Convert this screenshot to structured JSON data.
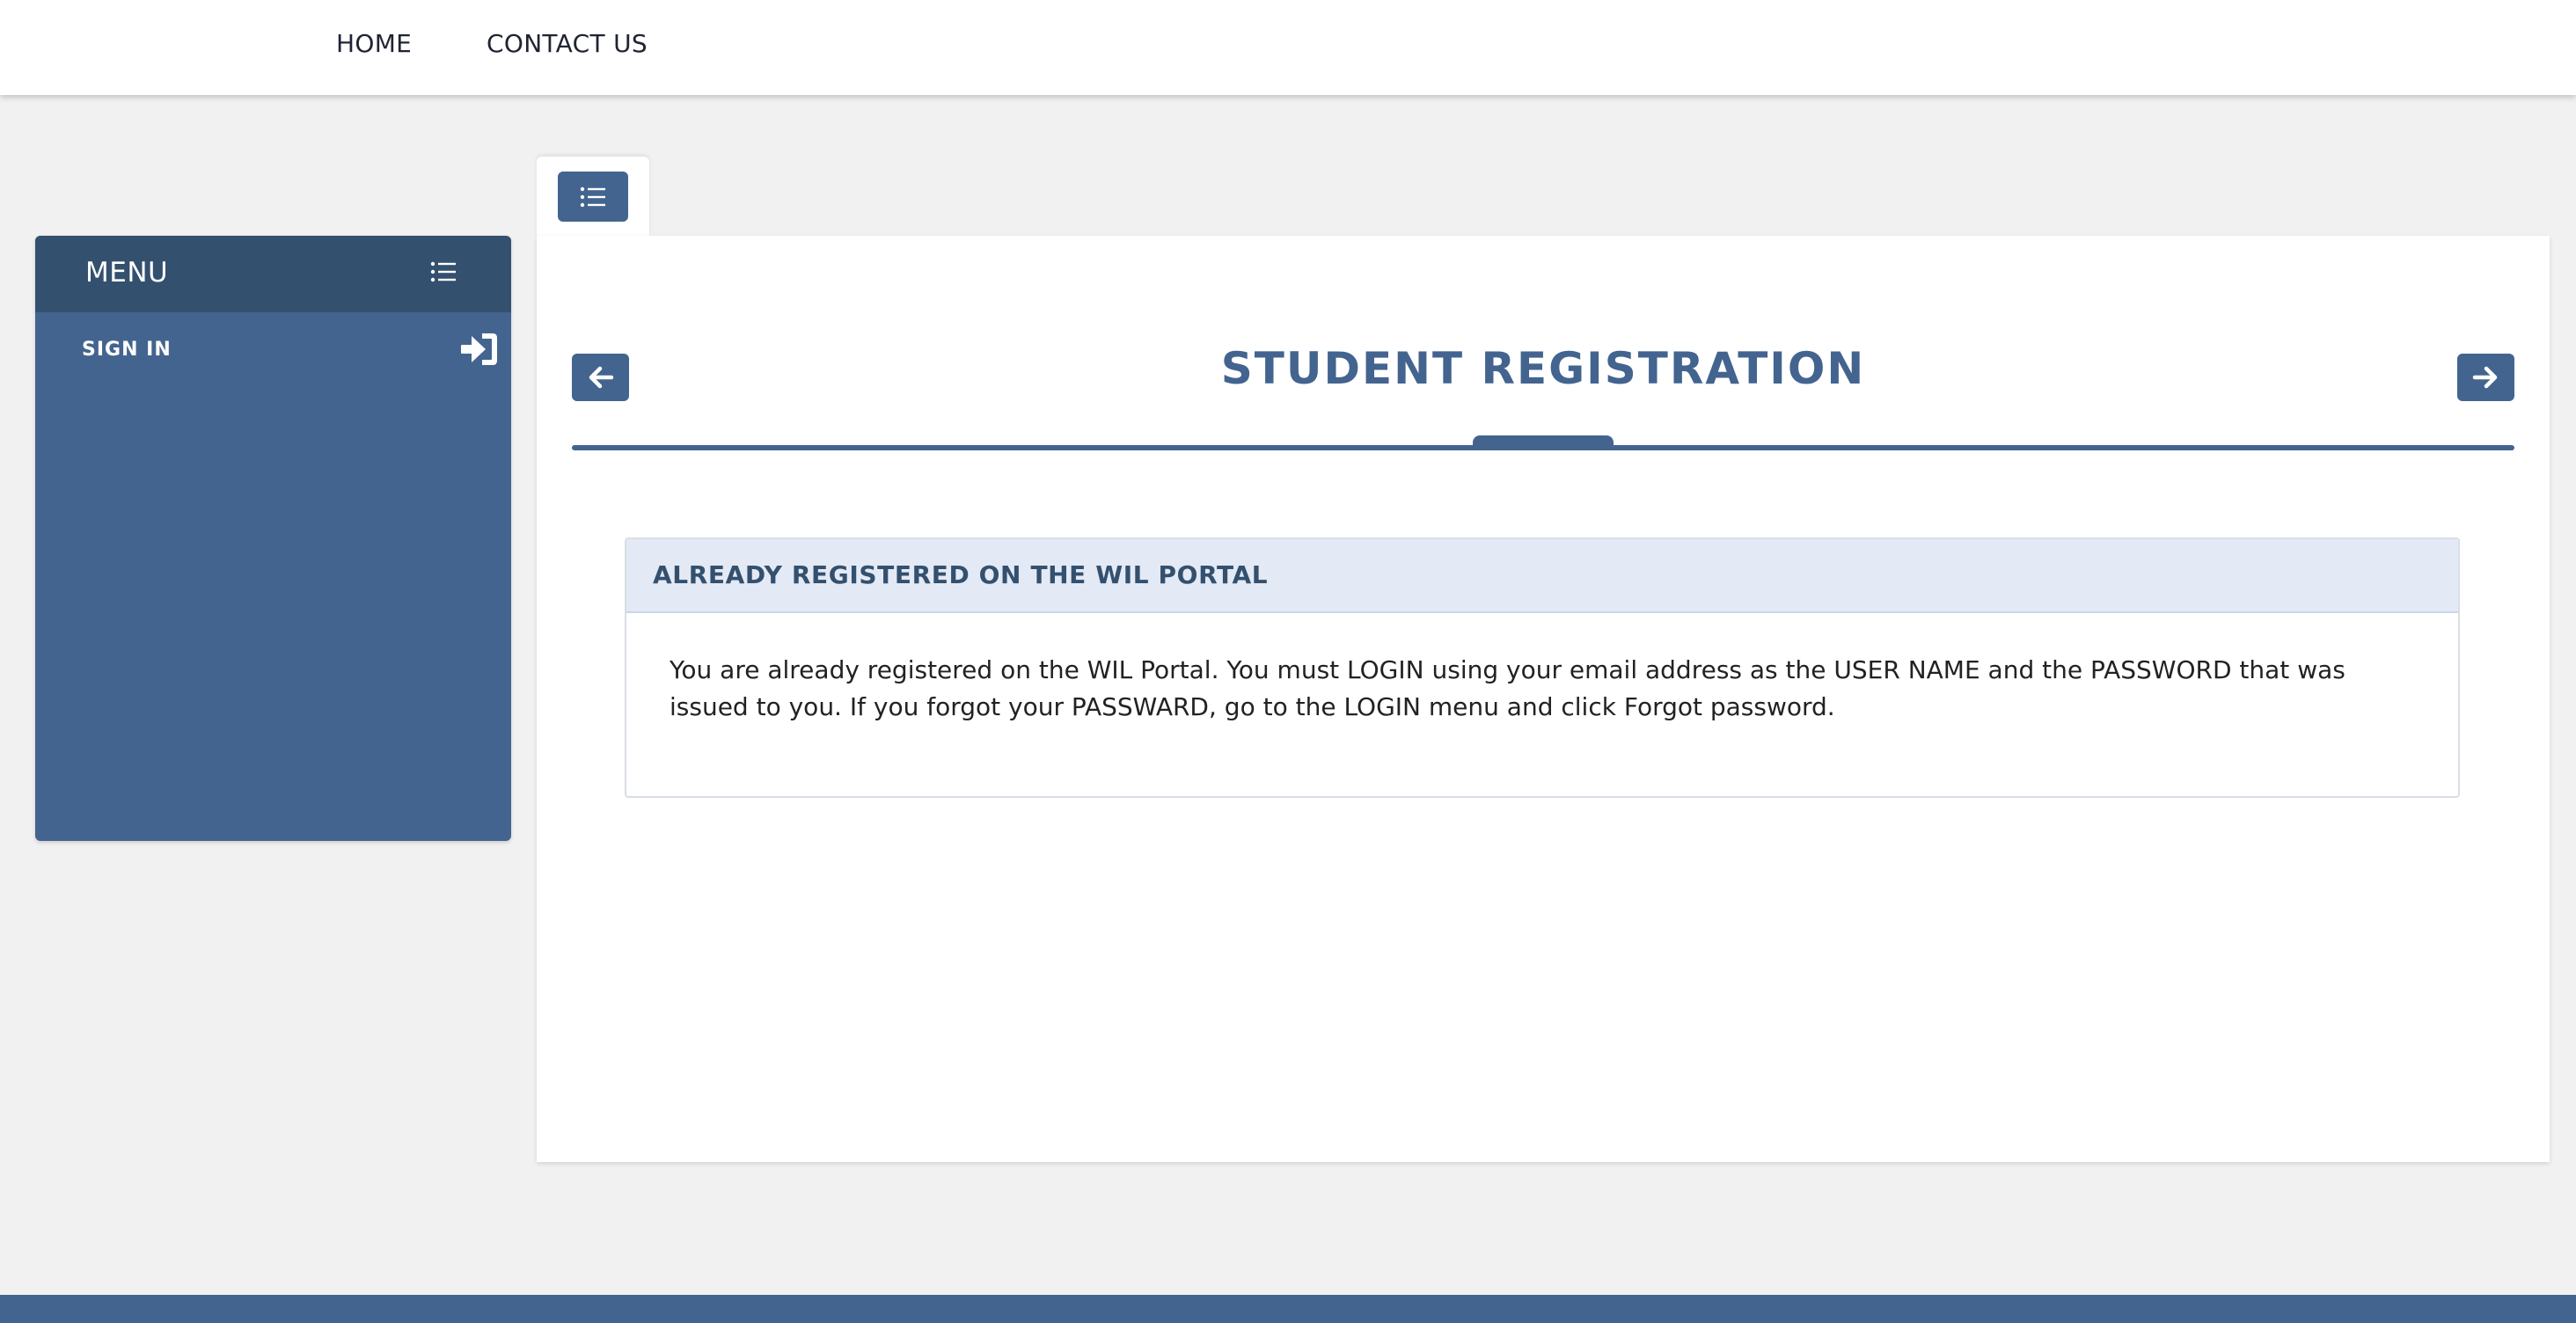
{
  "topnav": {
    "home": "HOME",
    "contact": "CONTACT US"
  },
  "sidebar": {
    "title": "MENU",
    "header_icon": "list-icon",
    "items": [
      {
        "label": "SIGN IN",
        "icon": "sign-in-icon"
      }
    ]
  },
  "tab": {
    "icon": "list-icon"
  },
  "main": {
    "title": "STUDENT REGISTRATION",
    "prev_icon": "arrow-left-icon",
    "next_icon": "arrow-right-icon"
  },
  "notice": {
    "heading": "ALREADY REGISTERED ON THE WIL PORTAL",
    "body": "You are already registered on the WIL Portal. You must LOGIN using your email address as the USER NAME and the PASSWORD that was issued to you. If you forgot your PASSWARD, go to the LOGIN menu and click Forgot password."
  },
  "colors": {
    "primary": "#43648f",
    "primary_dark": "#34506f",
    "panel_header": "#e3eaf5",
    "background": "#f1f1f1"
  }
}
